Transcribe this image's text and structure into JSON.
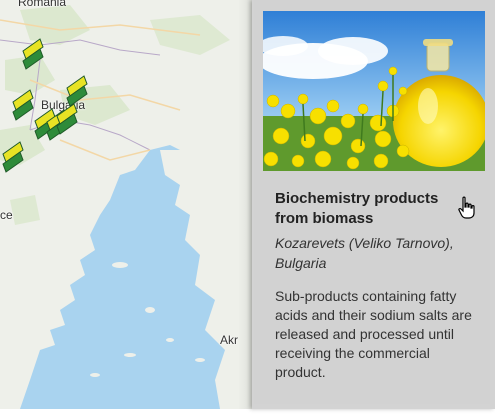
{
  "map": {
    "labels": {
      "romania": "Romania",
      "bulgaria": "Bulgaria",
      "france_partial": "ce",
      "akr_partial": "Akr"
    },
    "marker_icon": "biomass-leaf-marker-icon",
    "colors": {
      "sea": "#a9d3ef",
      "land": "#eef0ea",
      "marker_green": "#2e8b3a",
      "marker_yellow": "#e8e324"
    }
  },
  "popup": {
    "image_icon": "rapeseed-oil-photo",
    "title": "Biochemistry products from biomass",
    "location": "Kozarevets (Veliko Tarnovo), Bulgaria",
    "description": "Sub-products containing fatty acids and their sodium salts are released and processed until receiving the commercial product.",
    "cursor_icon": "hand-pointer-icon"
  }
}
